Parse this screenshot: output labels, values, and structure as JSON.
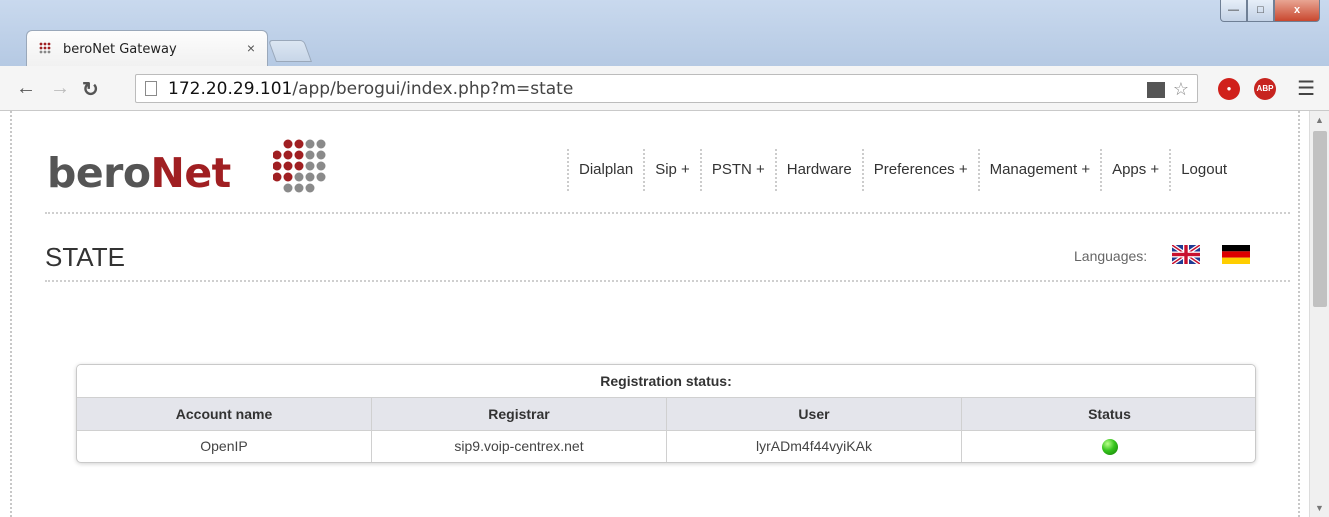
{
  "browser": {
    "tab_title": "beroNet Gateway",
    "tab_close": "×",
    "url_host": "172.20.29.101",
    "url_path": "/app/berogui/index.php?m=state",
    "window_buttons": {
      "minimize": "—",
      "maximize": "□",
      "close": "x"
    },
    "extensions": [
      {
        "name": "stop-icon",
        "color": "#d0201b"
      },
      {
        "name": "abp-icon",
        "label": "ABP",
        "color": "#c7241f"
      }
    ]
  },
  "brand": {
    "logo_gray": "bero",
    "logo_red": "Net",
    "red": "#a01f22",
    "gray": "#555555"
  },
  "nav": [
    "Dialplan",
    "Sip +",
    "PSTN +",
    "Hardware",
    "Preferences +",
    "Management +",
    "Apps +",
    "Logout"
  ],
  "page": {
    "title": "STATE",
    "languages_label": "Languages:",
    "languages": [
      "English",
      "German"
    ]
  },
  "registration": {
    "caption": "Registration status:",
    "columns": [
      "Account name",
      "Registrar",
      "User",
      "Status"
    ],
    "rows": [
      {
        "account": "OpenIP",
        "registrar": "sip9.voip-centrex.net",
        "user": "lyrADm4f44vyiKAk",
        "status": "registered",
        "status_color": "#35c41c"
      }
    ]
  }
}
